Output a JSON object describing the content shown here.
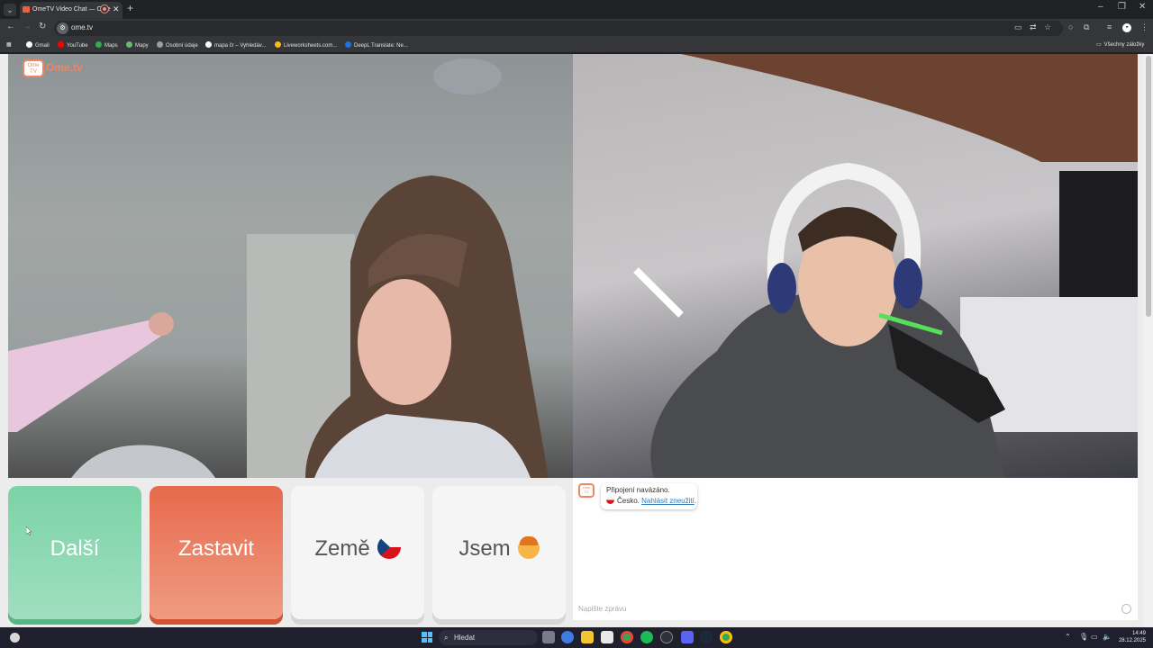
{
  "browser": {
    "tab_title": "OmeTV Video Chat — Ome",
    "url": "ome.tv",
    "bookmarks": [
      {
        "label": "Gmail",
        "color": "#ffffff"
      },
      {
        "label": "YouTube",
        "color": "#ff0000"
      },
      {
        "label": "Maps",
        "color": "#34a853"
      },
      {
        "label": "Mapy",
        "color": "#66bb6a"
      },
      {
        "label": "Osobní údaje",
        "color": "#9aa0a6"
      },
      {
        "label": "mapa čr – Vyhledáv...",
        "color": "#ffffff"
      },
      {
        "label": "Liveworksheets.com...",
        "color": "#fbbc04"
      },
      {
        "label": "DeepL Translate: Ne...",
        "color": "#1a73e8"
      }
    ],
    "all_bookmarks": "Všechny záložky"
  },
  "site": {
    "logo_text": "Ome.tv",
    "logo_badge": "Ome TV",
    "brand_color": "#f08561"
  },
  "controls": {
    "next": "Další",
    "stop": "Zastavit",
    "country": "Země",
    "gender": "Jsem"
  },
  "chat": {
    "status": "Připojení navázáno.",
    "country": "Česko.",
    "report_link": "Nahlásit zneužití",
    "input_placeholder": "Napište zprávu"
  },
  "taskbar": {
    "search": "Hledat",
    "time": "14:49",
    "date": "28.12.2025"
  }
}
